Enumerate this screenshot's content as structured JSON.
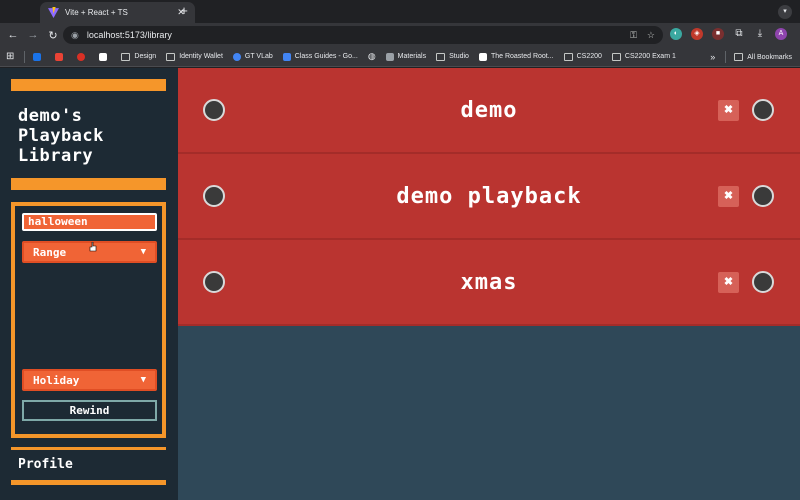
{
  "browser": {
    "tab_title": "Vite + React + TS",
    "tab_close_icon": "close-icon",
    "new_tab_symbol": "+",
    "url": "localhost:5173/library",
    "bookmarks": [
      "Design",
      "Identity Wallet",
      "GT VLab",
      "Class Guides - Go...",
      "Materials",
      "Studio",
      "The Roasted Root...",
      "CS2200",
      "CS2200 Exam 1"
    ],
    "all_bookmarks": "All Bookmarks",
    "profile_initial": "A"
  },
  "sidebar": {
    "title": "demo's Playback Library",
    "search_value": "halloween",
    "range_label": "Range",
    "holiday_label": "Holiday",
    "rewind_label": "Rewind",
    "profile_label": "Profile"
  },
  "playbacks": [
    {
      "name": "demo"
    },
    {
      "name": "demo playback"
    },
    {
      "name": "xmas"
    }
  ],
  "colors": {
    "accent_orange": "#f5962a",
    "row_red": "#ba3430",
    "input_orange": "#f06436",
    "sidebar_bg": "#1d2a34",
    "main_bg": "#2f4858"
  }
}
